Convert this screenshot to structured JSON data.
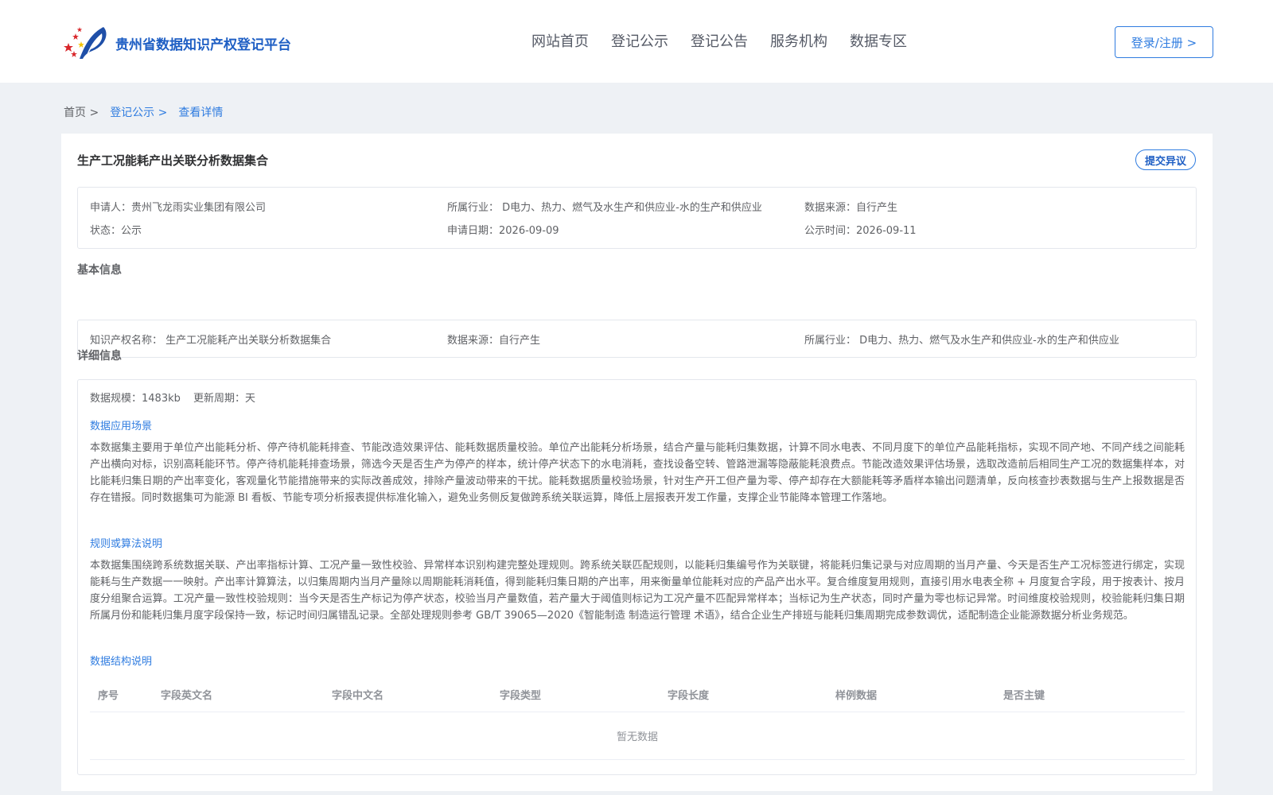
{
  "header": {
    "site_title": "贵州省数据知识产权登记平台",
    "nav": [
      "网站首页",
      "登记公示",
      "登记公告",
      "服务机构",
      "数据专区"
    ],
    "login_label": "登录/注册 >"
  },
  "breadcrumb": {
    "home": "首页 >",
    "list": "登记公示 >",
    "current": "查看详情"
  },
  "detail": {
    "title": "生产工况能耗产出关联分析数据集合",
    "objection_label": "提交异议",
    "summary": {
      "applicant": "申请人：贵州飞龙雨实业集团有限公司",
      "industry": "所属行业： D电力、热力、燃气及水生产和供应业-水的生产和供应业",
      "source": "数据来源：自行产生",
      "status": "状态：公示",
      "apply_date": "申请日期：2026-09-09",
      "publish_date": "公示时间：2026-09-11"
    },
    "basic_section_title": "基本信息",
    "basic": {
      "ip_name": "知识产权名称： 生产工况能耗产出关联分析数据集合",
      "source": "数据来源：自行产生",
      "industry": "所属行业： D电力、热力、燃气及水生产和供应业-水的生产和供应业"
    },
    "detail_section_title": "详细信息",
    "scale": "数据规模：1483kb",
    "cycle": "更新周期：天",
    "scenario_title": "数据应用场景",
    "scenario_text": "本数据集主要用于单位产出能耗分析、停产待机能耗排查、节能改造效果评估、能耗数据质量校验。单位产出能耗分析场景，结合产量与能耗归集数据，计算不同水电表、不同月度下的单位产品能耗指标，实现不同产地、不同产线之间能耗产出横向对标，识别高耗能环节。停产待机能耗排查场景，筛选今天是否生产为停产的样本，统计停产状态下的水电消耗，查找设备空转、管路泄漏等隐蔽能耗浪费点。节能改造效果评估场景，选取改造前后相同生产工况的数据集样本，对比能耗归集日期的产出率变化，客观量化节能措施带来的实际改善成效，排除产量波动带来的干扰。能耗数据质量校验场景，针对生产开工但产量为零、停产却存在大额能耗等矛盾样本输出问题清单，反向核查抄表数据与生产上报数据是否存在错报。同时数据集可为能源 BI 看板、节能专项分析报表提供标准化输入，避免业务侧反复做跨系统关联运算，降低上层报表开发工作量，支撑企业节能降本管理工作落地。",
    "rules_title": "规则或算法说明",
    "rules_text": "本数据集围绕跨系统数据关联、产出率指标计算、工况产量一致性校验、异常样本识别构建完整处理规则。跨系统关联匹配规则，以能耗归集编号作为关联键，将能耗归集记录与对应周期的当月产量、今天是否生产工况标签进行绑定，实现能耗与生产数据一一映射。产出率计算算法，以归集周期内当月产量除以周期能耗消耗值，得到能耗归集日期的产出率，用来衡量单位能耗对应的产品产出水平。复合维度复用规则，直接引用水电表全称 + 月度复合字段，用于按表计、按月度分组聚合运算。工况产量一致性校验规则：当今天是否生产标记为停产状态，校验当月产量数值，若产量大于阈值则标记为工况产量不匹配异常样本；当标记为生产状态，同时产量为零也标记异常。时间维度校验规则，校验能耗归集日期所属月份和能耗归集月度字段保持一致，标记时间归属错乱记录。全部处理规则参考 GB/T 39065⁠—2020《智能制造 制造运行管理 术语》，结合企业生产排班与能耗归集周期完成参数调优，适配制造企业能源数据分析业务规范。",
    "structure_title": "数据结构说明",
    "table": {
      "columns": [
        "序号",
        "字段英文名",
        "字段中文名",
        "字段类型",
        "字段长度",
        "样例数据",
        "是否主键"
      ],
      "empty_text": "暂无数据"
    }
  },
  "colors": {
    "primary": "#2f7ce0",
    "title_blue": "#1f5fc4",
    "page_bg": "#eef1f5",
    "logo_red": "#d8262a",
    "logo_yellow": "#f5c400"
  }
}
